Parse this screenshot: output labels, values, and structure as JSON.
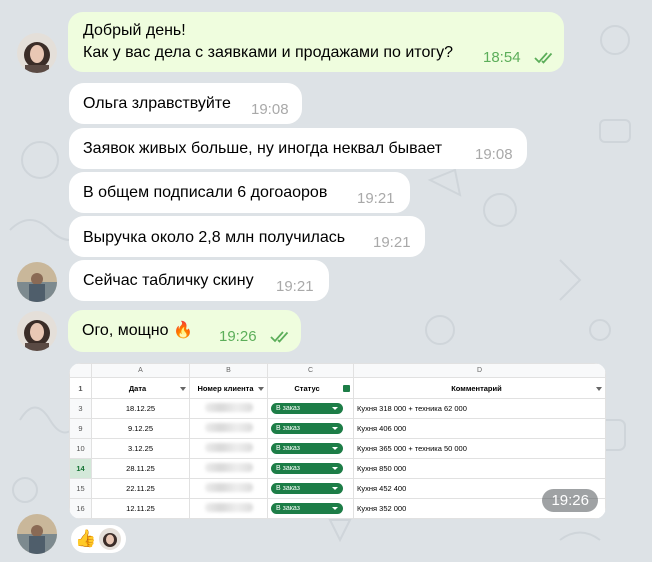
{
  "messages": [
    {
      "id": "m1",
      "text": "Добрый день!\nКак у вас дела с заявками и продажами по итогу?",
      "time": "18:54"
    },
    {
      "id": "m2",
      "text": "Ольга злравствуйте",
      "time": "19:08"
    },
    {
      "id": "m3",
      "text": "Заявок живых больше, ну иногда неквал бывает",
      "time": "19:08"
    },
    {
      "id": "m4",
      "text": "В общем подписали 6 догоаоров",
      "time": "19:21"
    },
    {
      "id": "m5",
      "text": "Выручка около 2,8 млн получилась",
      "time": "19:21"
    },
    {
      "id": "m6",
      "text": "Сейчас табличку скину",
      "time": "19:21"
    },
    {
      "id": "m7",
      "text": "Ого, мощно 🔥",
      "time": "19:26"
    }
  ],
  "image_message": {
    "time": "19:26",
    "spreadsheet": {
      "column_letters": [
        "A",
        "B",
        "C",
        "D"
      ],
      "headers": [
        "Дата",
        "Номер клиента",
        "Статус",
        "Комментарий"
      ],
      "header_row_number": "1",
      "rows": [
        {
          "n": "3",
          "date": "18.12.25",
          "status": "В заказ",
          "comment": "Кухня 318 000 + техника 62 000"
        },
        {
          "n": "9",
          "date": "9.12.25",
          "status": "В заказ",
          "comment": "Кухня 406 000"
        },
        {
          "n": "10",
          "date": "3.12.25",
          "status": "В заказ",
          "comment": "Кухня 365 000 + техника 50 000"
        },
        {
          "n": "14",
          "date": "28.11.25",
          "status": "В заказ",
          "comment": "Кухня 850 000"
        },
        {
          "n": "15",
          "date": "22.11.25",
          "status": "В заказ",
          "comment": "Кухня 452 400"
        },
        {
          "n": "16",
          "date": "12.11.25",
          "status": "В заказ",
          "comment": "Кухня 352 000"
        }
      ],
      "status_color": "#1d7d47"
    }
  },
  "reactions": [
    "thumbs-up",
    "avatar"
  ],
  "colors": {
    "outgoing_bubble": "#effdde",
    "incoming_bubble": "#ffffff",
    "background": "#dde2e6",
    "tick": "#5cae5a"
  }
}
